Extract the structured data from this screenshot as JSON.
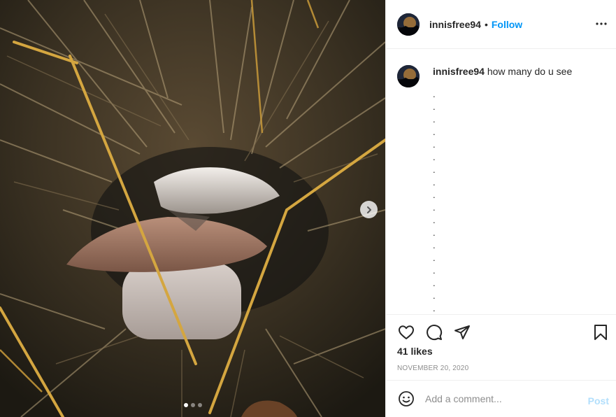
{
  "post": {
    "username": "innisfree94",
    "follow_label": "Follow",
    "separator": "•",
    "caption_text": "how many do u see",
    "caption_dots": [
      ".",
      ".",
      ".",
      ".",
      ".",
      ".",
      ".",
      ".",
      ".",
      ".",
      ".",
      ".",
      ".",
      ".",
      ".",
      ".",
      ".",
      "."
    ],
    "likes": "41 likes",
    "date": "NOVEMBER 20, 2020",
    "comment_placeholder": "Add a comment...",
    "post_label": "Post",
    "carousel": {
      "total": 3,
      "active_index": 0
    }
  },
  "icons": {
    "more": "more-options-icon",
    "like": "heart-icon",
    "comment": "comment-icon",
    "share": "share-icon",
    "save": "bookmark-icon",
    "emoji": "emoji-icon",
    "next": "chevron-right-icon"
  },
  "colors": {
    "accent": "#0095f6",
    "post_disabled": "#b2dffc",
    "muted": "#8e8e8e",
    "border": "#efefef"
  }
}
